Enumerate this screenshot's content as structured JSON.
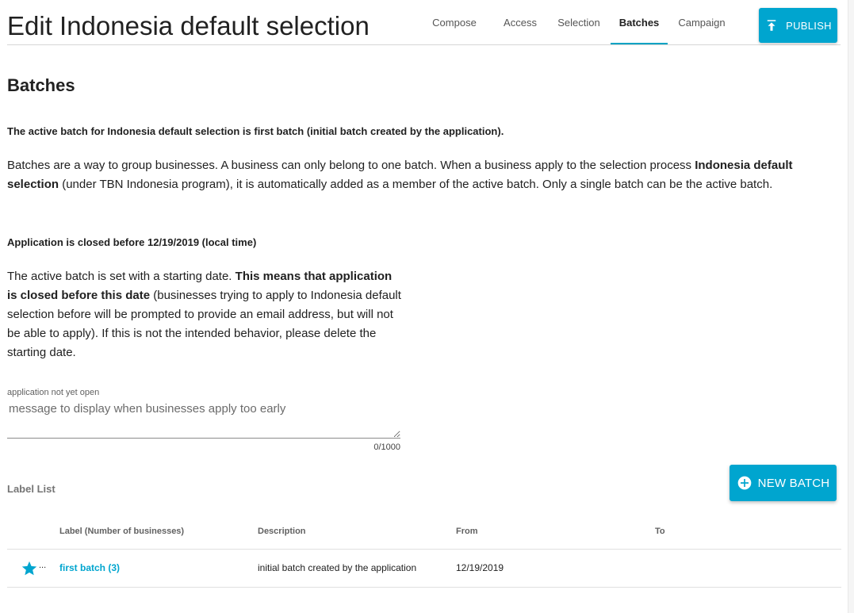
{
  "header": {
    "title": "Edit Indonesia default selection",
    "tabs": [
      {
        "label": "Compose",
        "active": false
      },
      {
        "label": "Access",
        "active": false
      },
      {
        "label": "Selection",
        "active": false
      },
      {
        "label": "Batches",
        "active": true
      },
      {
        "label": "Campaign",
        "active": false
      }
    ],
    "publish_label": "PUBLISH",
    "publish_icon": "upload-icon"
  },
  "batches": {
    "section_title": "Batches",
    "active_info": {
      "prefix": "The active batch for Indonesia default selection is ",
      "batch_name": "first batch",
      "suffix": " (initial batch created by the application)."
    },
    "explain": {
      "part1": "Batches are a way to group businesses. A business can only belong to one batch. When a business apply to the selection process ",
      "selection_name": "Indonesia default selection",
      "part2": " (under TBN Indonesia program), it is automatically added as a member of the active batch. Only a single batch can be the active batch."
    },
    "closed_heading": "Application is closed before 12/19/2019 (local time)",
    "closed_explain": {
      "part1": "The active batch is set with a starting date. ",
      "bold": "This means that application is closed before this date",
      "part2": " (businesses trying to apply to Indonesia default selection before will be prompted to provide an email address, but will not be able to apply). If this is not the intended behavior, please delete the starting date."
    },
    "message_field": {
      "label": "application not yet open",
      "placeholder": "message to display when businesses apply too early",
      "value": "",
      "counter": "0/1000"
    }
  },
  "label_list": {
    "title": "Label List",
    "new_batch_label": "NEW BATCH",
    "new_batch_icon": "add-circle-icon",
    "columns": [
      "Label (Number of businesses)",
      "Description",
      "From",
      "To"
    ],
    "rows": [
      {
        "active_icon": "star-icon",
        "more": "...",
        "label": "first batch (3)",
        "description": "initial batch created by the application",
        "from": "12/19/2019",
        "to": ""
      }
    ]
  },
  "colors": {
    "accent": "#00a5cf",
    "text": "#212121",
    "muted": "#757575"
  }
}
